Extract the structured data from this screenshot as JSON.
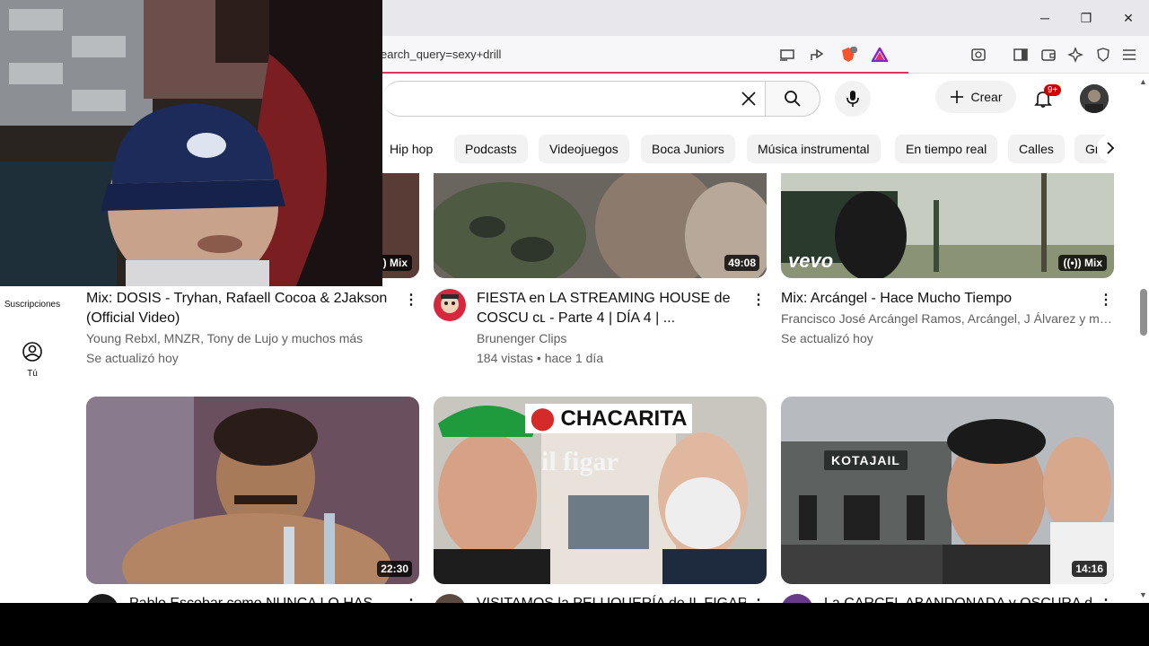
{
  "browser": {
    "url": "earch_query=sexy+drill",
    "window_buttons": {
      "minimize": "─",
      "maximize": "❐",
      "close": "✕"
    }
  },
  "masthead": {
    "create_label": "Crear",
    "notification_count": "9+"
  },
  "chips": [
    "Hip hop",
    "Podcasts",
    "Videojuegos",
    "Boca Juniors",
    "Música instrumental",
    "En tiempo real",
    "Calles",
    "Gr"
  ],
  "sidebar": {
    "subscriptions_label": "Suscripciones",
    "you_label": "Tú"
  },
  "videos_row1": [
    {
      "title_line1": "Mix: DOSIS - Tryhan, Rafaell Cocoa & 2Jakson",
      "title_line2": "(Official Video)",
      "meta1": "Young Rebxl, MNZR, Tony de Lujo y muchos más",
      "meta2": "Se actualizó hoy",
      "badge": "Mix"
    },
    {
      "title_line1": "FIESTA en LA STREAMING HOUSE de",
      "title_line2": "COSCU ᴄʟ - Parte 4 | DÍA 4 |  ...",
      "meta1": "Brunenger Clips",
      "meta2": "184 vistas • hace 1 día",
      "duration": "49:08"
    },
    {
      "title_line1": "Mix: Arcángel - Hace Mucho Tiempo",
      "meta1": "Francisco José Arcángel Ramos, Arcángel, J Álvarez y mu...",
      "meta2": "Se actualizó hoy",
      "badge": "Mix",
      "watermark": "vevo"
    }
  ],
  "videos_row2": [
    {
      "duration": "22:30",
      "title_partial": "Pablo Escobar como NUNCA LO HAS"
    },
    {
      "duration": "",
      "overlay_text": "CHACARITA",
      "sign_text": "il figar",
      "title_partial": "VISITAMOS la PELUQUERÍA de IL FIGARO"
    },
    {
      "duration": "14:16",
      "overlay_text": "KOTAJAIL",
      "title_partial": "La CARCEL ABANDONADA y OSCURA de"
    }
  ],
  "colors": {
    "accent_red": "#cc0000",
    "progress": "#e0345e",
    "text_primary": "#0f0f0f",
    "text_secondary": "#606060"
  }
}
